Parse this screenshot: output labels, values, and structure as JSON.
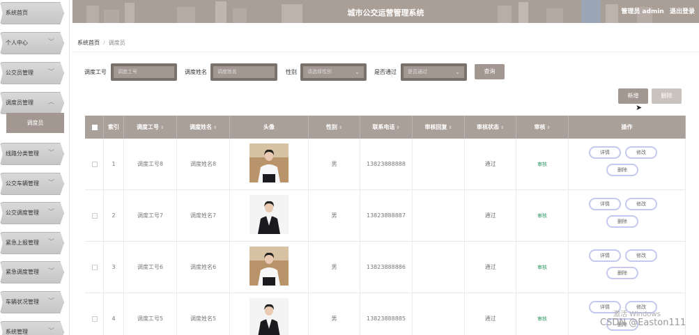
{
  "header": {
    "title": "城市公交运营管理系统",
    "user": "管理员 admin",
    "logout": "退出登录"
  },
  "sidebar": {
    "items": [
      {
        "label": "系统首页",
        "expanded": false
      },
      {
        "label": "个人中心",
        "expanded": false
      },
      {
        "label": "公交员管理",
        "expanded": false
      },
      {
        "label": "调度员管理",
        "expanded": true
      },
      {
        "label": "线路分类管理",
        "expanded": false
      },
      {
        "label": "公交车辆管理",
        "expanded": false
      },
      {
        "label": "公交调度管理",
        "expanded": false
      },
      {
        "label": "紧急上报管理",
        "expanded": false
      },
      {
        "label": "紧急调度管理",
        "expanded": false
      },
      {
        "label": "车辆状况管理",
        "expanded": false
      },
      {
        "label": "系统管理",
        "expanded": false
      }
    ],
    "subitem": "调度员"
  },
  "breadcrumb": {
    "home": "系统首页",
    "separator": "/",
    "current": "调度员"
  },
  "search": {
    "job_no_label": "调度工号",
    "job_no_placeholder": "调度工号",
    "name_label": "调度姓名",
    "name_placeholder": "调度姓名",
    "gender_label": "性别",
    "gender_placeholder": "请选择性别",
    "passed_label": "是否通过",
    "passed_placeholder": "是否通过",
    "query_button": "查询"
  },
  "actions": {
    "add": "新增",
    "delete": "删除"
  },
  "table": {
    "columns": [
      "索引",
      "调度工号",
      "调度姓名",
      "头像",
      "性别",
      "联系电话",
      "审核回复",
      "审核状态",
      "审核",
      "操作"
    ],
    "rows": [
      {
        "index": "1",
        "job_no": "调度工号8",
        "name": "调度姓名8",
        "avatar": "woman-white-shirt",
        "gender": "男",
        "phone": "13823888888",
        "reply": "",
        "status": "通过",
        "audit": "审核"
      },
      {
        "index": "2",
        "job_no": "调度工号7",
        "name": "调度姓名7",
        "avatar": "woman-black-suit",
        "gender": "男",
        "phone": "13823888887",
        "reply": "",
        "status": "通过",
        "audit": "审核"
      },
      {
        "index": "3",
        "job_no": "调度工号6",
        "name": "调度姓名6",
        "avatar": "woman-white-shirt",
        "gender": "男",
        "phone": "13823888886",
        "reply": "",
        "status": "通过",
        "audit": "审核"
      },
      {
        "index": "4",
        "job_no": "调度工号5",
        "name": "调度姓名5",
        "avatar": "woman-black-suit",
        "gender": "男",
        "phone": "13823888885",
        "reply": "",
        "status": "通过",
        "audit": "审核"
      }
    ],
    "ops": {
      "detail": "详情",
      "edit": "修改",
      "delete": "删除"
    }
  },
  "overlay": {
    "windows_hint": "激活 Windows",
    "watermark": "CSDN @Easton111"
  },
  "colors": {
    "accent": "#a39891",
    "header_bg": "#aa9f97",
    "audit_link": "#2b9a63",
    "op_border": "#c5c8ef"
  }
}
